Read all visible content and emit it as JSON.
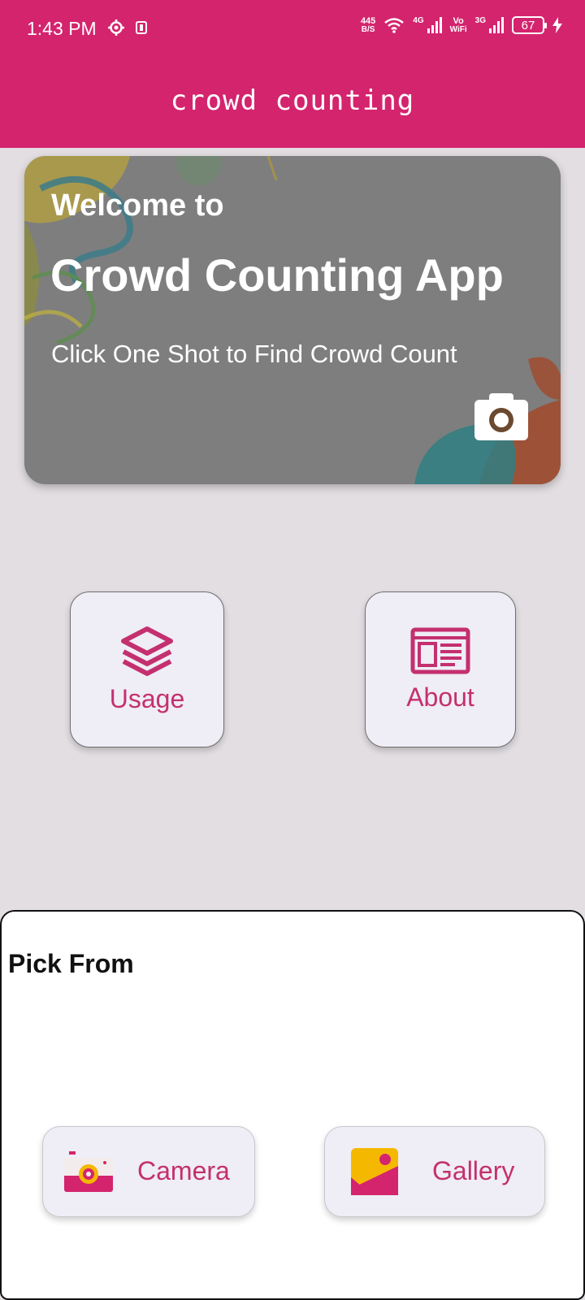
{
  "status_bar": {
    "time": "1:43 PM",
    "net_speed_value": "445",
    "net_speed_unit": "B/S",
    "network_1": "4G",
    "volte_top": "Vo",
    "volte_bottom": "WiFi",
    "network_2": "3G",
    "battery_level": "67"
  },
  "app_bar": {
    "title": "crowd counting"
  },
  "hero": {
    "welcome": "Welcome to",
    "title": "Crowd Counting App",
    "subtitle": "Click One Shot to Find Crowd Count"
  },
  "tiles": {
    "usage_label": "Usage",
    "about_label": "About"
  },
  "sheet": {
    "title": "Pick From",
    "camera_label": "Camera",
    "gallery_label": "Gallery"
  },
  "colors": {
    "brand": "#d4246e",
    "accent_text": "#c4306f",
    "tile_bg": "#efedf5",
    "background": "#e2dee2"
  },
  "icons": {
    "hero": "camera-icon",
    "usage": "layers-icon",
    "about": "article-icon",
    "camera": "camera-icon",
    "gallery": "image-icon"
  }
}
